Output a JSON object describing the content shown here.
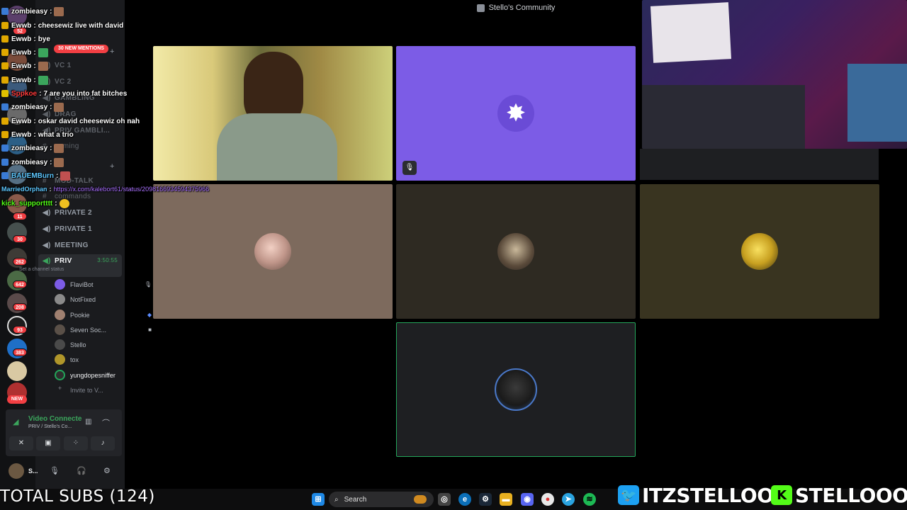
{
  "window": {
    "title": "Stello's Community"
  },
  "rail": {
    "badges": [
      "52",
      "11",
      "30",
      "262",
      "642",
      "208",
      "93",
      "383"
    ],
    "new_label": "NEW"
  },
  "sidebar": {
    "mentions": "30 NEW MENTIONS",
    "channels": [
      {
        "label": "VC 1"
      },
      {
        "label": "VC 2"
      },
      {
        "label": "GAMBLING"
      },
      {
        "label": "DRAG"
      },
      {
        "label": "PRIV GAMBLI..."
      },
      {
        "label": "gaming"
      },
      {
        "label": "MOD-TALK"
      },
      {
        "label": "commands"
      },
      {
        "label": "PRIVATE 2"
      },
      {
        "label": "PRIVATE 1"
      },
      {
        "label": "MEETING"
      }
    ],
    "active_channel": {
      "label": "PRIV",
      "time": "3:50:55",
      "status": "Set a channel status"
    },
    "voice_users": [
      {
        "name": "FlaviBot"
      },
      {
        "name": "NotFixed"
      },
      {
        "name": "Pookie"
      },
      {
        "name": "Seven Soc..."
      },
      {
        "name": "Stello"
      },
      {
        "name": "tox"
      },
      {
        "name": "yungdopesniffer"
      }
    ],
    "invite": "Invite to V...",
    "voice_panel": {
      "title": "Video Connecte",
      "subtitle": "PRIV / Stello's Co..."
    },
    "user": {
      "name": "S..."
    }
  },
  "chat": [
    {
      "user": "zombieasy",
      "text": "",
      "color": "#ffffff"
    },
    {
      "user": "Ewwb",
      "text": "cheesewiz live with david",
      "color": "#ffffff"
    },
    {
      "user": "Ewwb",
      "text": "bye",
      "color": "#ffffff"
    },
    {
      "user": "Ewwb",
      "text": "",
      "color": "#ffffff"
    },
    {
      "user": "Ewwb",
      "text": "",
      "color": "#ffffff"
    },
    {
      "user": "Ewwb",
      "text": "",
      "color": "#ffffff"
    },
    {
      "user": "Sppkoe",
      "text": "7 are you into fat bitches",
      "color": "#ff3b3b"
    },
    {
      "user": "zombieasy",
      "text": "",
      "color": "#ffffff"
    },
    {
      "user": "Ewwb",
      "text": "oskar david cheesewiz oh nah",
      "color": "#ffffff"
    },
    {
      "user": "Ewwb",
      "text": "what a trio",
      "color": "#ffffff"
    },
    {
      "user": "zombieasy",
      "text": "",
      "color": "#ffffff"
    },
    {
      "user": "zombieasy",
      "text": "",
      "color": "#ffffff"
    },
    {
      "user": "BAUEMBurn",
      "text": "",
      "color": "#5ec8ff"
    },
    {
      "user": "MarriedOrphan",
      "text": "https://x.com/kalebort61/status/2098166934594375966",
      "color": "#5ec8ff"
    },
    {
      "user": "kick_supportttt",
      "text": "",
      "color": "#53fc18"
    }
  ],
  "taskbar": {
    "search_placeholder": "Search"
  },
  "overlay": {
    "total_subs": "TOTAL SUBS (124)",
    "twitter": "ITZSTELLOO",
    "kick": "STELLOOO"
  },
  "colors": {
    "accent_green": "#23a55a",
    "purple_tile": "#7c5ce6",
    "tile_brown": "#7d6a5d",
    "tile_dark": "#2e2a22",
    "tile_olive": "#393420"
  }
}
